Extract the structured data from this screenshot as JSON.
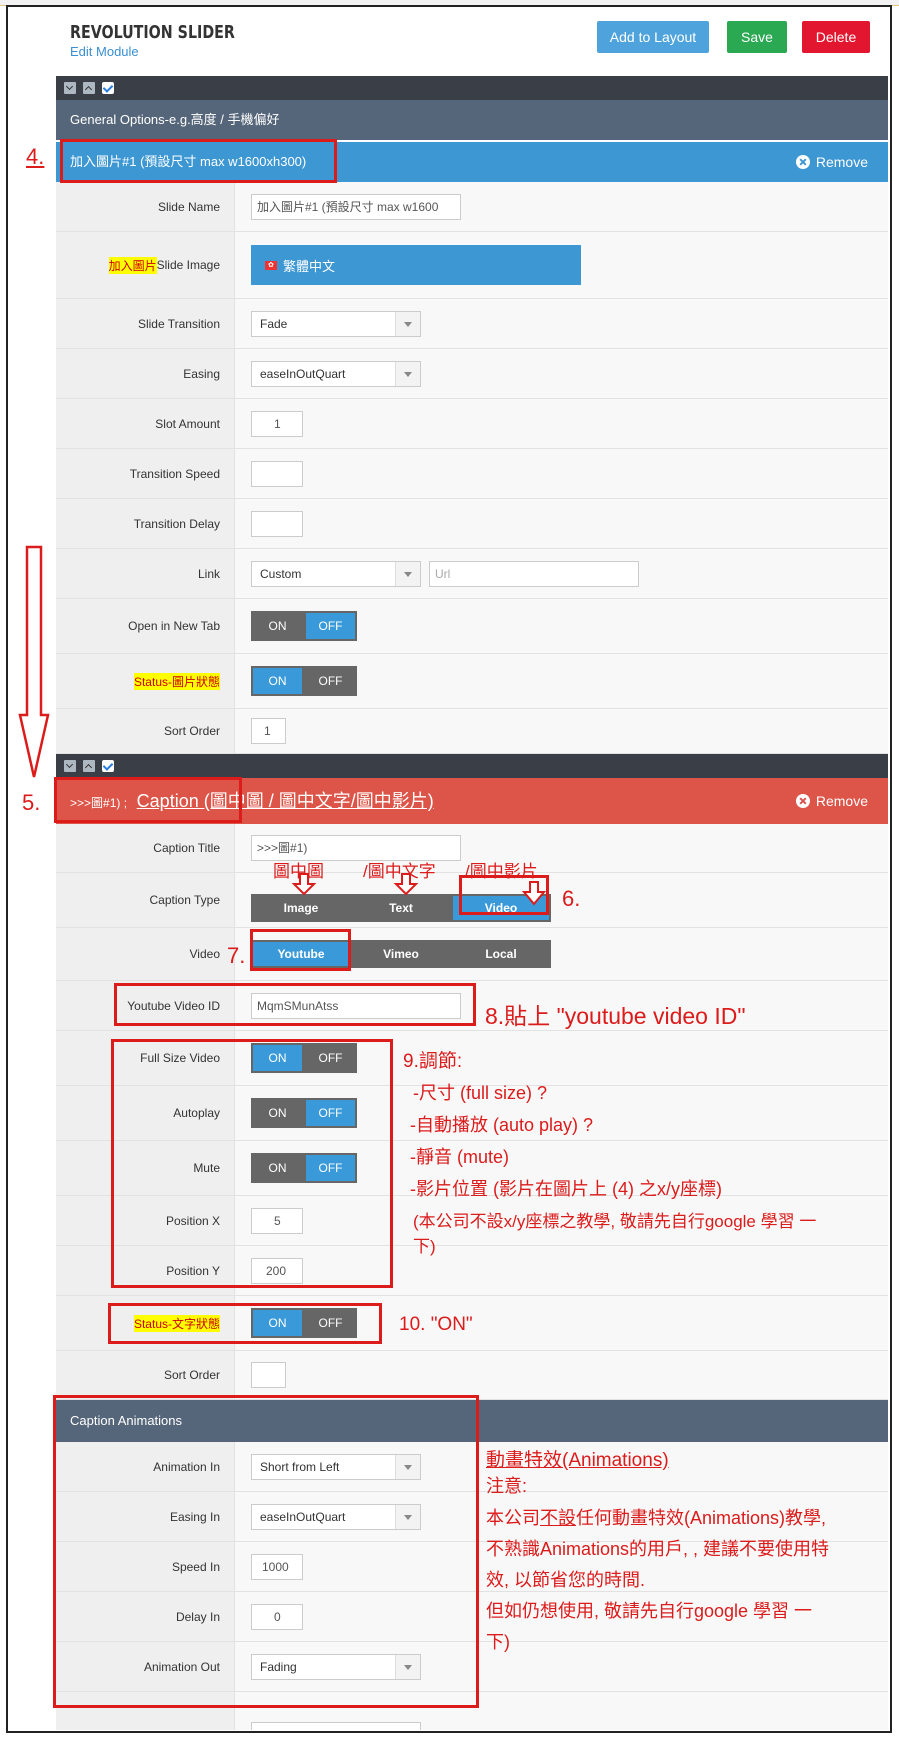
{
  "header": {
    "title": "REVOLUTION SLIDER",
    "subtitle": "Edit Module",
    "add_layout": "Add to Layout",
    "save": "Save",
    "delete": "Delete"
  },
  "general": {
    "label": "General Options-e.g.高度 / 手機偏好"
  },
  "slide": {
    "head": "加入圖片#1 (預設尺寸 max w1600xh300)",
    "remove": "Remove",
    "name_label": "Slide Name",
    "name_value": "加入圖片#1 (預設尺寸 max w1600",
    "image_label_hl": "加入圖片",
    "image_label": "Slide Image",
    "image_button": "繁體中文",
    "transition_label": "Slide Transition",
    "transition_value": "Fade",
    "easing_label": "Easing",
    "easing_value": "easeInOutQuart",
    "slot_label": "Slot Amount",
    "slot_value": "1",
    "speed_label": "Transition Speed",
    "delay_label": "Transition Delay",
    "link_label": "Link",
    "link_value": "Custom",
    "url_placeholder": "Url",
    "newtab_label": "Open in New Tab",
    "status_label": "Status-圖片狀態",
    "sort_label": "Sort Order",
    "sort_value": "1"
  },
  "toggle": {
    "on": "ON",
    "off": "OFF"
  },
  "caption": {
    "head_prefix": ">>>圖#1) ;",
    "head_main": "Caption (圖中圖 / 圖中文字/圖中影片)",
    "remove": "Remove",
    "title_label": "Caption Title",
    "title_value": ">>>圖#1)",
    "type_label": "Caption Type",
    "type_image": "Image",
    "type_text": "Text",
    "type_video": "Video",
    "video_label": "Video",
    "video_youtube": "Youtube",
    "video_vimeo": "Vimeo",
    "video_local": "Local",
    "ytid_label": "Youtube Video ID",
    "ytid_value": "MqmSMunAtss",
    "fullsize_label": "Full Size Video",
    "autoplay_label": "Autoplay",
    "mute_label": "Mute",
    "posx_label": "Position X",
    "posx_value": "5",
    "posy_label": "Position Y",
    "posy_value": "200",
    "status_label": "Status-文字狀態",
    "sort_label": "Sort Order"
  },
  "animations": {
    "head": "Caption Animations",
    "in_label": "Animation In",
    "in_value": "Short from Left",
    "easing_label": "Easing In",
    "easing_value": "easeInOutQuart",
    "speed_label": "Speed In",
    "speed_value": "1000",
    "delay_label": "Delay In",
    "delay_value": "0",
    "out_label": "Animation Out",
    "out_value": "Fading"
  },
  "annotations": {
    "a4": "4.",
    "a5": "5.",
    "a6": "6.",
    "a7": "7.",
    "a8": "8.貼上 \"youtube video ID\"",
    "t_image": "圖中圖",
    "t_text": "/圖中文字",
    "t_video": "/圖中影片",
    "a9_title": "9.調節:",
    "a9_1": "-尺寸 (full size) ?",
    "a9_2": "-自動播放 (auto play) ?",
    "a9_3": "-靜音 (mute)",
    "a9_4": "-影片位置 (影片在圖片上 (4) 之x/y座標)",
    "a9_5a": "(本公司不設x/y座標之教學, 敬請先自行google 學習 一",
    "a9_5b": "下)",
    "a10": "10.  \"ON\"",
    "anim_title": "動畫特效(Animations)",
    "anim_note": "注意:",
    "anim_l1_a": "本公司",
    "anim_l1_u": "不設",
    "anim_l1_b": "任何動畫特效(Animations)教學,",
    "anim_l2": "不熟識Animations的用戶, , 建議不要使用特",
    "anim_l3": "效, 以節省您的時間.",
    "anim_l4": "但如仍想使用, 敬請先自行google 學習 一",
    "anim_l5": "下)"
  }
}
